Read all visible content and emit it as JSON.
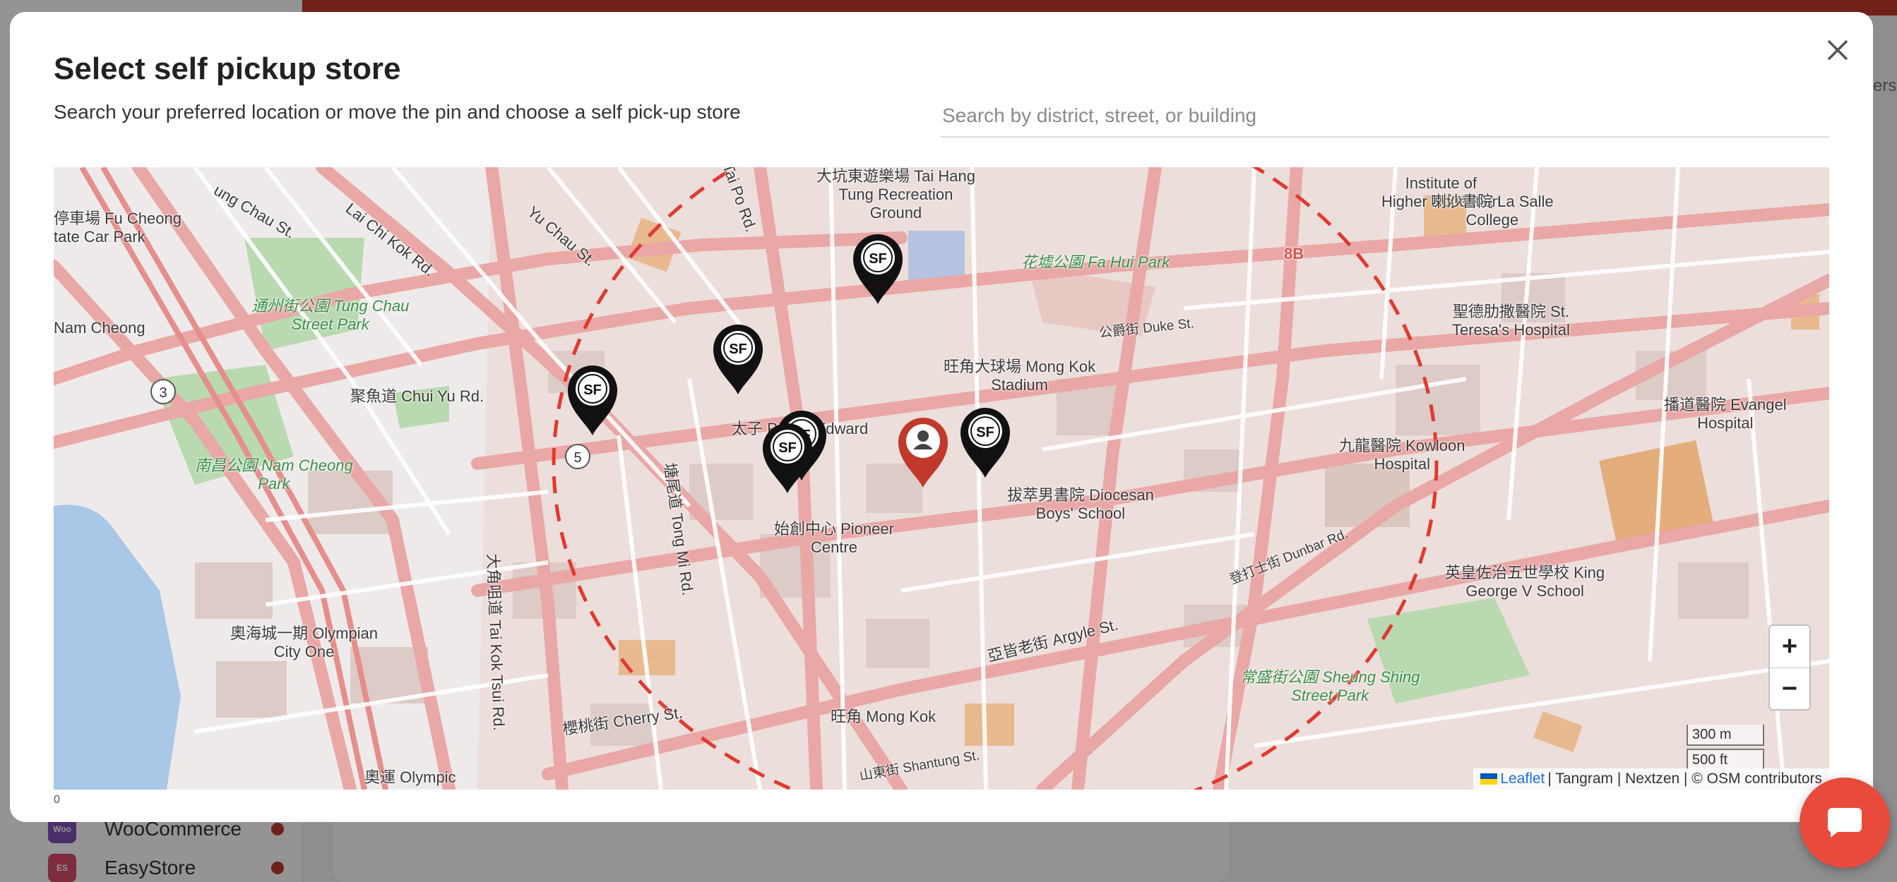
{
  "background": {
    "sidebar_items": [
      {
        "label": "WooCommerce",
        "logo_text": "Woo"
      },
      {
        "label": "EasyStore",
        "logo_text": "ES"
      }
    ],
    "right_text": "sers"
  },
  "modal": {
    "title": "Select self pickup store",
    "subtitle": "Search your preferred location or move the pin and choose a self pick-up store",
    "search_placeholder": "Search by district, street, or building",
    "footnote": "0"
  },
  "map": {
    "labels": [
      {
        "text": "停車場 Fu Cheong\ntate Car Park"
      },
      {
        "text": "Nam Cheong"
      },
      {
        "text": "Lai Chi Kok Rd."
      },
      {
        "text": "ung Chau St."
      },
      {
        "text": "Yu Chau St."
      },
      {
        "text": "Tai Po Rd."
      },
      {
        "text": "大坑東遊樂場 Tai Hang\nTung Recreation\nGround"
      },
      {
        "text": "花墟公園 Fa Hui Park"
      },
      {
        "text": "Institute of\nHigher Education"
      },
      {
        "text": "喇沙書院 La Salle\nCollege"
      },
      {
        "text": "通州街公園 Tung Chau\nStreet Park"
      },
      {
        "text": "旺角大球場 Mong Kok\nStadium"
      },
      {
        "text": "聚魚道 Chui Yu Rd."
      },
      {
        "text": "聖德肋撒醫院 St.\nTeresa's Hospital"
      },
      {
        "text": "播道醫院 Evangel\nHospital"
      },
      {
        "text": "太子 Prince Edward"
      },
      {
        "text": "九龍醫院 Kowloon\nHospital"
      },
      {
        "text": "南昌公園 Nam Cheong\nPark"
      },
      {
        "text": "塘尾道 Tong Mi Rd."
      },
      {
        "text": "拔萃男書院 Diocesan\nBoys' School"
      },
      {
        "text": "始創中心 Pioneer\nCentre"
      },
      {
        "text": "英皇佐治五世學校 King\nGeorge V School"
      },
      {
        "text": "奧海城一期 Olympian\nCity One"
      },
      {
        "text": "大角咀道 Tai Kok Tsui Rd."
      },
      {
        "text": "亞皆老街 Argyle St."
      },
      {
        "text": "常盛街公園 Sheung Shing\nStreet Park"
      },
      {
        "text": "旺角 Mong Kok"
      },
      {
        "text": "櫻桃街 Cherry St."
      },
      {
        "text": "奧運 Olympic"
      },
      {
        "text": "山東街 Shantung St."
      },
      {
        "text": "登打士街 Dunbar Rd."
      },
      {
        "text": "公爵街 Duke St."
      },
      {
        "text": "8B"
      }
    ],
    "pins": [
      {
        "name": "sf-store-pin-1",
        "type": "sf"
      },
      {
        "name": "sf-store-pin-2",
        "type": "sf"
      },
      {
        "name": "sf-store-pin-3",
        "type": "sf"
      },
      {
        "name": "sf-store-pin-4",
        "type": "sf"
      },
      {
        "name": "sf-store-pin-5",
        "type": "sf"
      },
      {
        "name": "sf-store-pin-6",
        "type": "sf"
      },
      {
        "name": "user-location-pin",
        "type": "user"
      }
    ],
    "pin_badge": "SF",
    "route_badges": [
      "3",
      "5"
    ],
    "zoom_in_label": "+",
    "zoom_out_label": "−",
    "scale_metric": "300 m",
    "scale_imperial": "500 ft",
    "attribution": {
      "leaflet": "Leaflet",
      "rest": "| Tangram | Nextzen | © OSM contributors"
    },
    "colors": {
      "sf_pin": "#111111",
      "user_pin": "#c0392b",
      "radius_ring": "#e03a2f",
      "park": "#b9d9b1",
      "water": "#a9c7e6"
    }
  }
}
